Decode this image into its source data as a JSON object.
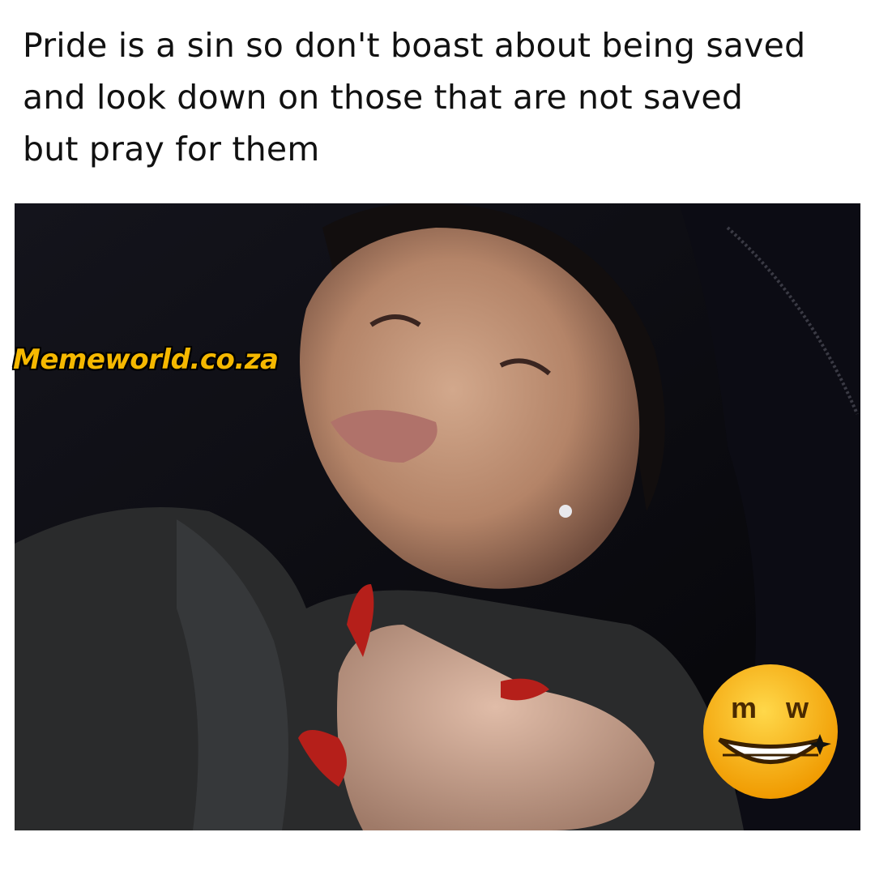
{
  "caption": {
    "lines": [
      "Pride is a sin so don't boast about being saved",
      "and look down on those that are not saved",
      "but pray for them"
    ]
  },
  "photo": {
    "subject": "photo"
  },
  "watermark": {
    "text": "Memeworld.co.za",
    "color": "#f5b800"
  },
  "logo": {
    "letters": "m w",
    "icon": "grinning-face-logo-icon",
    "color": "#f6b600"
  }
}
